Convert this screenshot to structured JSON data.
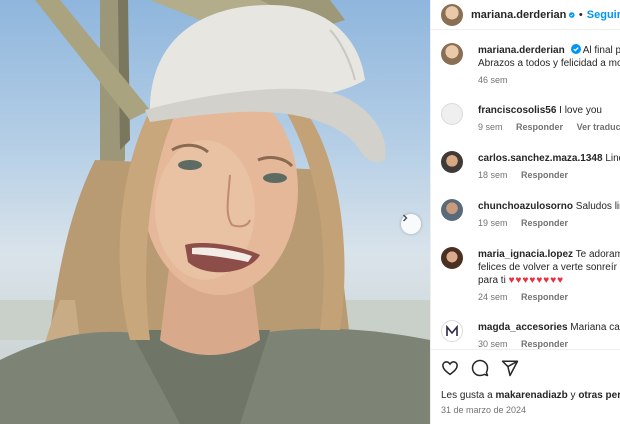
{
  "post": {
    "username": "mariana.derderian",
    "follow_label": "Seguir",
    "dot": "•"
  },
  "caption": {
    "author": "mariana.derderian",
    "line1": "Al final pa",
    "line2": "Abrazos a todos y felicidad a mo",
    "time": "46 sem"
  },
  "comments": [
    {
      "author": "franciscosolis56",
      "text": "I love you",
      "time": "9 sem",
      "reply": "Responder",
      "translate": "Ver traducción",
      "avatar_icon": "default-avatar-icon"
    },
    {
      "author": "carlos.sanchez.maza.1348",
      "text": "Linda",
      "time": "18 sem",
      "reply": "Responder",
      "avatar_icon": "user-photo-avatar"
    },
    {
      "author": "chunchoazulosorno",
      "text": "Saludos lind",
      "time": "19 sem",
      "reply": "Responder",
      "avatar_icon": "user-photo-avatar"
    },
    {
      "author": "maria_ignacia.lopez",
      "text": "Te adoramo",
      "line2": "felices de volver a verte sonreír !",
      "line3": "para ti",
      "hearts": "♥♥♥♥♥♥♥♥",
      "time": "24 sem",
      "reply": "Responder",
      "avatar_icon": "user-photo-avatar"
    },
    {
      "author": "magda_accesories",
      "text": "Mariana cada",
      "time": "30 sem",
      "reply": "Responder",
      "avatar_icon": "monogram-m-avatar"
    }
  ],
  "footer": {
    "likes_prefix": "Les gusta a",
    "likes_user": "makarenadiazb",
    "likes_connector": "y",
    "likes_others": "otras perso",
    "date": "31 de marzo de 2024"
  },
  "colors": {
    "accent": "#0095f6",
    "heart": "#ed2d3f",
    "muted": "#737373"
  }
}
